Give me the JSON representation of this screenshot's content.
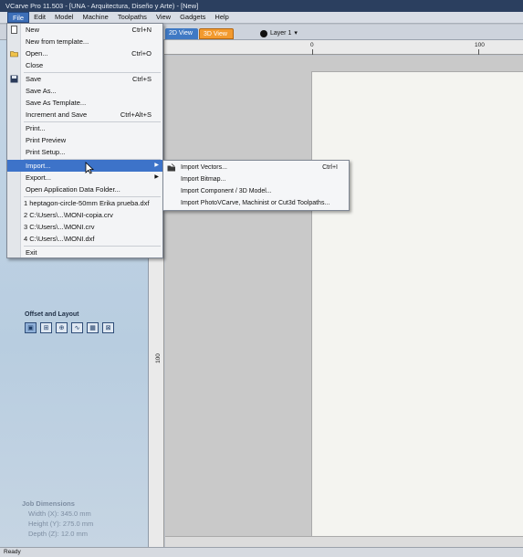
{
  "window": {
    "title": "VCarve Pro 11.503 - [UNA - Arquitectura, Diseño y Arte) - [New]"
  },
  "menubar": {
    "items": [
      "File",
      "Edit",
      "Model",
      "Machine",
      "Toolpaths",
      "View",
      "Gadgets",
      "Help"
    ],
    "active": "File"
  },
  "toolbar": {
    "tab_2d": "2D View",
    "tab_3d": "3D View",
    "layer_label": "Layer 1"
  },
  "ruler": {
    "h_labels": [
      "0",
      "100"
    ],
    "v_label": "100"
  },
  "file_menu": {
    "items": [
      {
        "label": "New",
        "shortcut": "Ctrl+N",
        "icon": "new-file-icon"
      },
      {
        "label": "New from template...",
        "shortcut": ""
      },
      {
        "label": "Open...",
        "shortcut": "Ctrl+O",
        "icon": "open-folder-icon"
      },
      {
        "label": "Close",
        "shortcut": ""
      },
      {
        "label": "Save",
        "shortcut": "Ctrl+S",
        "icon": "save-disk-icon"
      },
      {
        "label": "Save As...",
        "shortcut": ""
      },
      {
        "label": "Save As Template...",
        "shortcut": ""
      },
      {
        "label": "Increment and Save",
        "shortcut": "Ctrl+Alt+S"
      },
      {
        "label": "Print...",
        "shortcut": ""
      },
      {
        "label": "Print Preview",
        "shortcut": ""
      },
      {
        "label": "Print Setup...",
        "shortcut": ""
      },
      {
        "label": "Import...",
        "shortcut": "",
        "submenu": true
      },
      {
        "label": "Export...",
        "shortcut": "",
        "submenu": true
      },
      {
        "label": "Open Application Data Folder...",
        "shortcut": ""
      },
      {
        "label": "1 heptagon-circle-50mm Erika prueba.dxf",
        "shortcut": ""
      },
      {
        "label": "2 C:\\Users\\...\\MONI-copia.crv",
        "shortcut": ""
      },
      {
        "label": "3 C:\\Users\\...\\MONI.crv",
        "shortcut": ""
      },
      {
        "label": "4 C:\\Users\\...\\MONI.dxf",
        "shortcut": ""
      },
      {
        "label": "Exit",
        "shortcut": ""
      }
    ],
    "highlighted": "Import..."
  },
  "import_submenu": {
    "items": [
      {
        "label": "Import Vectors...",
        "shortcut": "Ctrl+I",
        "icon": "import-vectors-icon"
      },
      {
        "label": "Import Bitmap...",
        "shortcut": ""
      },
      {
        "label": "Import Component / 3D Model...",
        "shortcut": ""
      },
      {
        "label": "Import PhotoVCarve, Machinist or Cut3d Toolpaths...",
        "shortcut": ""
      }
    ]
  },
  "left_panel": {
    "offset_title": "Offset and Layout",
    "offset_icons": [
      "offset-icon",
      "array-copy-icon",
      "circular-array-icon",
      "fit-curve-icon",
      "nesting-icon",
      "table-layout-icon"
    ],
    "job_dimensions": {
      "title": "Job Dimensions",
      "width": "Width  (X): 345.0 mm",
      "height": "Height (Y): 275.0 mm",
      "depth": "Depth  (Z): 12.0 mm"
    }
  },
  "status": {
    "text": "Ready"
  },
  "colors": {
    "accent_highlight": "#3d73c9",
    "tab_3d": "#f29a2e",
    "tab_2d": "#3f79c4",
    "title_bar": "#2b3f5f"
  }
}
